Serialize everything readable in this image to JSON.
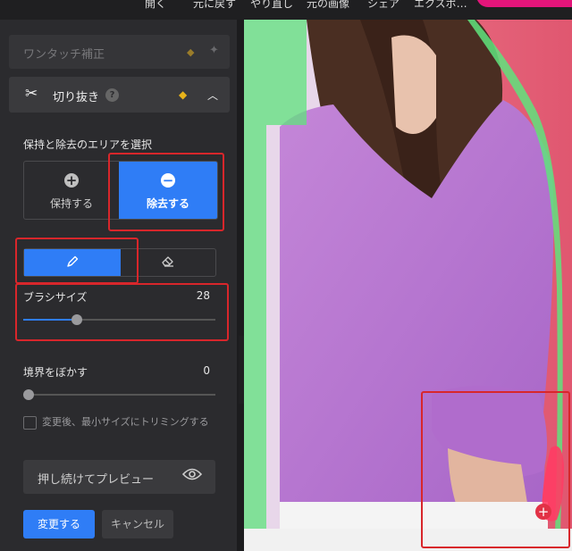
{
  "toolbar": {
    "open": "開く",
    "undo": "元に戻す",
    "redo": "やり直し",
    "original": "元の画像",
    "share": "シェア",
    "export": "エクスポ…"
  },
  "panel": {
    "one_touch_label": "ワンタッチ補正",
    "crop_label": "切り抜き",
    "help_glyph": "?",
    "section_title": "保持と除去のエリアを選択",
    "keep_label": "保持する",
    "remove_label": "除去する",
    "brush_size_label": "ブラシサイズ",
    "brush_size_value": "28",
    "brush_size_level": 0.28,
    "feather_label": "境界をぼかす",
    "feather_value": "0",
    "feather_level": 0,
    "trim_label": "変更後、最小サイズにトリミングする",
    "preview_label": "押し続けてプレビュー",
    "apply_label": "変更する",
    "cancel_label": "キャンセル"
  },
  "icons": {
    "crop": "scissors-icon",
    "premium": "diamond-icon",
    "magic": "magic-wand-icon",
    "collapse": "chevron-up-icon",
    "keep": "plus-circle-icon",
    "remove": "minus-circle-icon",
    "brush": "brush-icon",
    "eraser": "eraser-icon",
    "preview": "eye-icon",
    "panel_toggle": "chevron-left-icon"
  },
  "colors": {
    "accent": "#2f7df6",
    "annotation": "#d8262b",
    "keep_mask": "#5fe37c",
    "remove_mask": "#ff3c64",
    "premium_gold": "#e8b31a"
  }
}
